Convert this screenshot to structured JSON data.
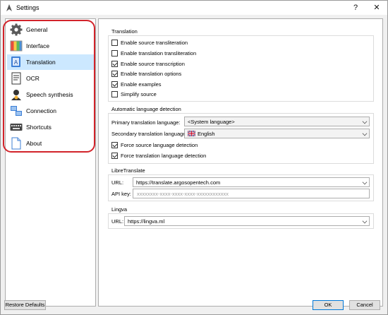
{
  "window": {
    "title": "Settings",
    "help_glyph": "?",
    "close_glyph": "✕"
  },
  "sidebar": {
    "items": [
      {
        "label": "General",
        "icon": "gear-icon"
      },
      {
        "label": "Interface",
        "icon": "interface-icon"
      },
      {
        "label": "Translation",
        "icon": "translation-icon",
        "selected": true
      },
      {
        "label": "OCR",
        "icon": "ocr-icon"
      },
      {
        "label": "Speech synthesis",
        "icon": "speech-icon"
      },
      {
        "label": "Connection",
        "icon": "connection-icon"
      },
      {
        "label": "Shortcuts",
        "icon": "keyboard-icon"
      },
      {
        "label": "About",
        "icon": "about-icon"
      }
    ]
  },
  "translation": {
    "title": "Translation",
    "options": [
      {
        "label": "Enable source transliteration",
        "checked": false
      },
      {
        "label": "Enable translation transliteration",
        "checked": false
      },
      {
        "label": "Enable source transcription",
        "checked": true
      },
      {
        "label": "Enable translation options",
        "checked": true
      },
      {
        "label": "Enable examples",
        "checked": true
      },
      {
        "label": "Simplify source",
        "checked": false
      }
    ]
  },
  "detection": {
    "title": "Automatic language detection",
    "primary_label": "Primary translation language:",
    "primary_value": "<System language>",
    "secondary_label": "Secondary translation language:",
    "secondary_value": "English",
    "force_source": {
      "label": "Force source language detection",
      "checked": true
    },
    "force_translation": {
      "label": "Force translation language detection",
      "checked": true
    }
  },
  "libretranslate": {
    "title": "LibreTranslate",
    "url_label": "URL:",
    "url_value": "https://translate.argosopentech.com",
    "apikey_label": "API key:",
    "apikey_placeholder": "xxxxxxxx-xxxx-xxxx-xxxx-xxxxxxxxxxxx"
  },
  "lingva": {
    "title": "Lingva",
    "url_label": "URL:",
    "url_value": "https://lingva.ml"
  },
  "footer": {
    "restore_label": "Restore Defaults",
    "ok_label": "OK",
    "cancel_label": "Cancel"
  },
  "colors": {
    "selection": "#cce8ff",
    "highlight_outline": "#d2232a",
    "focus_border": "#0078d7"
  }
}
